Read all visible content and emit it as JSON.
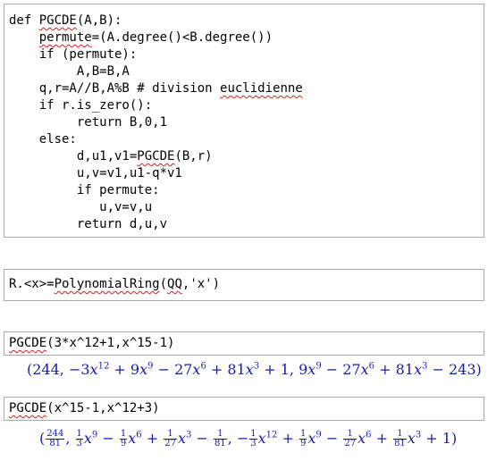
{
  "cells": {
    "cell1": {
      "lines": [
        [
          "def ",
          {
            "w": "PGCDE"
          },
          "(A,B):"
        ],
        [
          "    ",
          {
            "w": "permute"
          },
          "=(A.degree()<B.degree())"
        ],
        [
          "    if (permute):"
        ],
        [
          "         A,B=B,A"
        ],
        [
          "    q,r=A//B,A%B # division ",
          {
            "w": "euclidienne"
          }
        ],
        [
          "    if r.is_zero():"
        ],
        [
          "         return B,0,1"
        ],
        [
          "    else:"
        ],
        [
          "         d,u1,v1=",
          {
            "w": "PGCDE"
          },
          "(B,r)"
        ],
        [
          "         u,v=v1,u1-q*v1"
        ],
        [
          "         if permute:"
        ],
        [
          "            u,v=v,u"
        ],
        [
          "         return d,u,v"
        ]
      ]
    },
    "cell2": {
      "parts": [
        "R.<x>=",
        {
          "w": "PolynomialRing"
        },
        "(",
        {
          "w": "QQ"
        },
        ",'x')"
      ]
    },
    "cell3": {
      "parts": [
        {
          "w": "PGCDE"
        },
        "(3*x^12+1,x^15-1)"
      ],
      "output": "(244, −3x¹² + 9x⁹ − 27x⁶ + 81x³ + 1, 9x⁹ − 27x⁶ + 81x³ − 243)"
    },
    "cell4": {
      "parts": [
        {
          "w": "PGCDE"
        },
        "(x^15-1,x^12+3)"
      ],
      "output": "(244/81, 1/3x⁹ − 1/9x⁶ + 1/27x³ − 1/81, −1/3x¹² + 1/9x⁹ − 1/27x⁶ + 1/81x³ + 1)"
    }
  },
  "colors": {
    "border": "#a9a9a9",
    "output": "#1a1aa6",
    "squiggle": "#d02020"
  }
}
